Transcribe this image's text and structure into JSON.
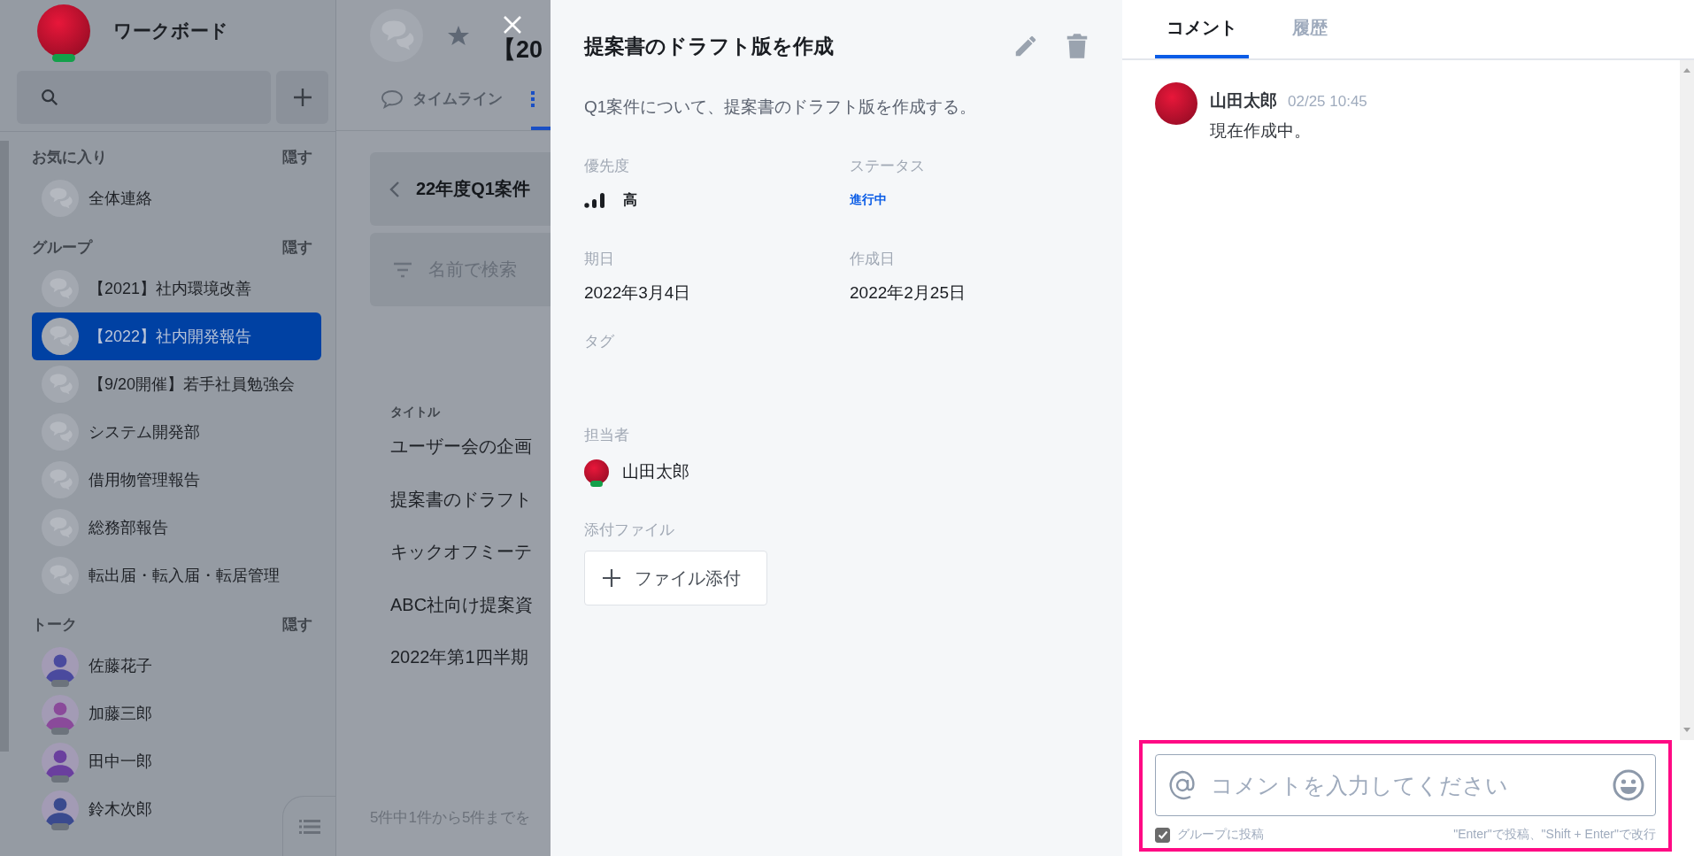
{
  "sidebar": {
    "app_title": "ワークボード",
    "user_online": true,
    "sections": [
      {
        "title": "お気に入り",
        "hide_label": "隠す",
        "items": [
          {
            "label": "全体連絡",
            "kind": "group",
            "selected": false
          }
        ]
      },
      {
        "title": "グループ",
        "hide_label": "隠す",
        "items": [
          {
            "label": "【2021】社内環境改善",
            "kind": "group",
            "selected": false
          },
          {
            "label": "【2022】社内開発報告",
            "kind": "group",
            "selected": true
          },
          {
            "label": "【9/20開催】若手社員勉強会",
            "kind": "group",
            "selected": false
          },
          {
            "label": "システム開発部",
            "kind": "group",
            "selected": false
          },
          {
            "label": "借用物管理報告",
            "kind": "group",
            "selected": false
          },
          {
            "label": "総務部報告",
            "kind": "group",
            "selected": false
          },
          {
            "label": "転出届・転入届・転居管理",
            "kind": "group",
            "selected": false
          }
        ]
      },
      {
        "title": "トーク",
        "hide_label": "隠す",
        "items": [
          {
            "label": "佐藤花子",
            "kind": "person",
            "color": "#4a4a9e",
            "online": false,
            "selected": false
          },
          {
            "label": "加藤三郎",
            "kind": "person",
            "color": "#8a4a9a",
            "online": false,
            "selected": false
          },
          {
            "label": "田中一郎",
            "kind": "person",
            "color": "#6a3f9e",
            "online": false,
            "selected": false
          },
          {
            "label": "鈴木次郎",
            "kind": "person",
            "color": "#3a4a8e",
            "online": false,
            "selected": false
          }
        ]
      }
    ]
  },
  "middle": {
    "title": "【20",
    "tabs": [
      {
        "kind": "chat",
        "label": "タイムライン",
        "selected": false
      },
      {
        "kind": "list",
        "selected": true
      }
    ],
    "breadcrumb": "22年度Q1案件",
    "filter_placeholder": "名前で検索",
    "column": "タイトル",
    "rows": [
      "ユーザー会の企画",
      "提案書のドラフト",
      "キックオフミーテ",
      "ABC社向け提案資",
      "2022年第1四半期"
    ],
    "footer": "5件中1件から5件までを"
  },
  "detail": {
    "title": "提案書のドラフト版を作成",
    "description": "Q1案件について、提案書のドラフト版を作成する。",
    "priority": {
      "label": "優先度",
      "value": "高"
    },
    "status": {
      "label": "ステータス",
      "value": "進行中"
    },
    "due": {
      "label": "期日",
      "value": "2022年3月4日"
    },
    "created": {
      "label": "作成日",
      "value": "2022年2月25日"
    },
    "tags": {
      "label": "タグ"
    },
    "assignee": {
      "label": "担当者",
      "name": "山田太郎",
      "online": true
    },
    "attachments": {
      "label": "添付ファイル",
      "button": "ファイル添付"
    }
  },
  "comments": {
    "tabs": [
      {
        "label": "コメント",
        "selected": true
      },
      {
        "label": "履歴",
        "selected": false
      }
    ],
    "items": [
      {
        "author": "山田太郎",
        "time": "02/25 10:45",
        "text": "現在作成中。"
      }
    ],
    "input": {
      "placeholder": "コメントを入力してください",
      "highlighted": true
    },
    "post_to_group": {
      "label": "グループに投稿",
      "checked": true
    },
    "hint": "\"Enter\"で投稿、\"Shift + Enter\"で改行"
  }
}
